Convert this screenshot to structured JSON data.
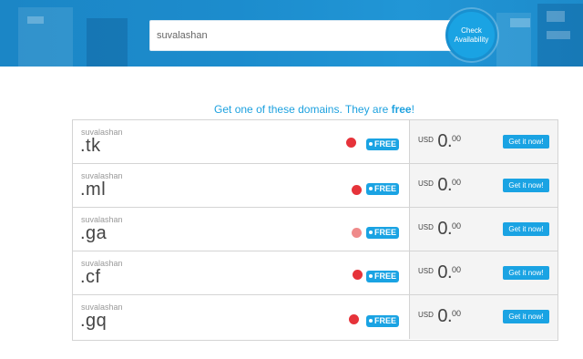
{
  "search": {
    "value": "suvalashan",
    "button_label": "Check Availability"
  },
  "headline": {
    "text": "Get one of these domains. They are ",
    "emphasis": "free",
    "suffix": "!"
  },
  "domains": [
    {
      "name": "suvalashan",
      "tld": ".tk",
      "badge": "FREE",
      "currency": "USD",
      "price_whole": "0.",
      "price_cents": "00",
      "action": "Get it now!",
      "status_color": "#e6333a"
    },
    {
      "name": "suvalashan",
      "tld": ".ml",
      "badge": "FREE",
      "currency": "USD",
      "price_whole": "0.",
      "price_cents": "00",
      "action": "Get it now!",
      "status_color": "#e6333a"
    },
    {
      "name": "suvalashan",
      "tld": ".ga",
      "badge": "FREE",
      "currency": "USD",
      "price_whole": "0.",
      "price_cents": "00",
      "action": "Get it now!",
      "status_color": "#ef8a8a"
    },
    {
      "name": "suvalashan",
      "tld": ".cf",
      "badge": "FREE",
      "currency": "USD",
      "price_whole": "0.",
      "price_cents": "00",
      "action": "Get it now!",
      "status_color": "#e6333a"
    },
    {
      "name": "suvalashan",
      "tld": ".gq",
      "badge": "FREE",
      "currency": "USD",
      "price_whole": "0.",
      "price_cents": "00",
      "action": "Get it now!",
      "status_color": "#e6333a"
    }
  ],
  "colors": {
    "accent": "#1aa3e3",
    "banner": "#1c8ccd",
    "status_red": "#e6333a"
  }
}
